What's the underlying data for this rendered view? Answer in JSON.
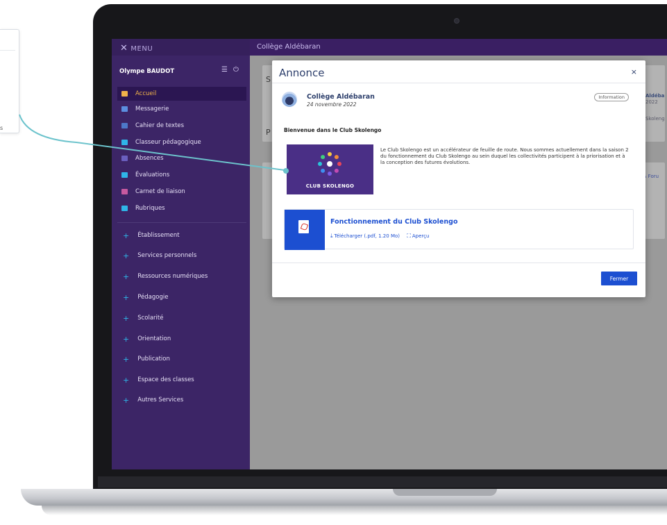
{
  "sidebar": {
    "menu_label": "MENU",
    "user_name": "Olympe BAUDOT",
    "items": [
      {
        "label": "Accueil",
        "icon": "home-grid-icon",
        "color": "#f0b24a",
        "active": true
      },
      {
        "label": "Messagerie",
        "icon": "mail-icon",
        "color": "#5c8fe0"
      },
      {
        "label": "Cahier de textes",
        "icon": "notebook-icon",
        "color": "#4d78c8"
      },
      {
        "label": "Classeur pédagogique",
        "icon": "folder-icon",
        "color": "#2fb5e8"
      },
      {
        "label": "Absences",
        "icon": "person-icon",
        "color": "#6a5fbf"
      },
      {
        "label": "Évaluations",
        "icon": "bar-chart-icon",
        "color": "#2fb5e8"
      },
      {
        "label": "Carnet de liaison",
        "icon": "link-icon",
        "color": "#c75aa0"
      },
      {
        "label": "Rubriques",
        "icon": "board-icon",
        "color": "#2fb5e8"
      }
    ],
    "sections": [
      "Établissement",
      "Services personnels",
      "Ressources numériques",
      "Pédagogie",
      "Scolarité",
      "Orientation",
      "Publication",
      "Espace des classes",
      "Autres Services"
    ]
  },
  "topbar": {
    "school": "Collège Aldébaran"
  },
  "background": {
    "letter_s": "S",
    "letter_p": "P",
    "right_text_1": "Aldéba",
    "right_text_2": "2022",
    "right_text_3": "Skoleng",
    "right_text_4": "& Foru",
    "left_callout_text": "s"
  },
  "modal": {
    "title": "Annonce",
    "close_glyph": "×",
    "author": "Collège Aldébaran",
    "date": "24 novembre 2022",
    "tag": "Information",
    "heading": "Bienvenue dans le Club Skolengo",
    "image_caption": "CLUB SKOLENGO",
    "body": "Le Club Skolengo est un accélérateur de feuille de route. Nous sommes actuellement dans la saison 2 du fonctionnement du Club Skolengo au sein duquel les collectivités participent à la priorisation et à la conception des futures évolutions.",
    "attachment": {
      "title": "Fonctionnement du Club Skolengo",
      "download": "Télécharger (.pdf, 1.20 Mo)",
      "preview": "Aperçu"
    },
    "close_button": "Fermer"
  },
  "colors": {
    "sidebar": "#3c2566",
    "topbar": "#3a1f63",
    "accent_blue": "#1c4fd1",
    "active_label": "#f0b24a",
    "connector": "#6cc3cc"
  }
}
